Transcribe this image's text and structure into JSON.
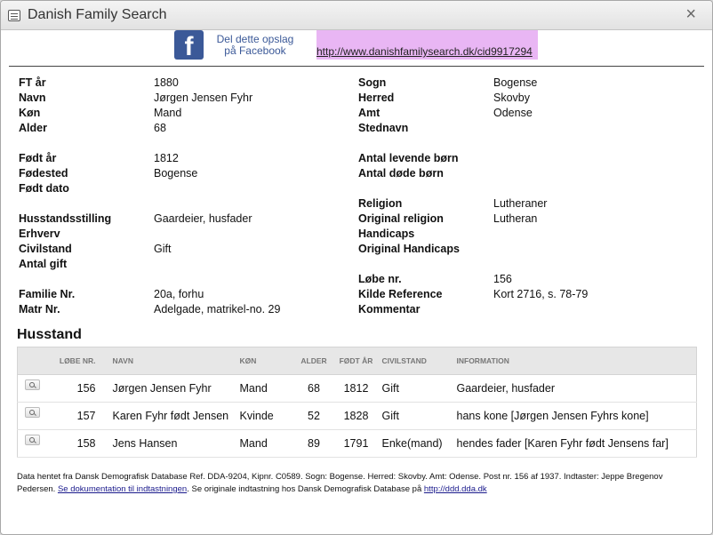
{
  "window": {
    "title": "Danish Family Search",
    "close": "×"
  },
  "share": {
    "facebook_text_line1": "Del dette opslag",
    "facebook_text_line2": "på Facebook",
    "permalink": "http://www.danishfamilysearch.dk/cid9917294",
    "facebook_logo": "f"
  },
  "fields_left": [
    {
      "label": "FT år",
      "value": "1880"
    },
    {
      "label": "Navn",
      "value": "Jørgen Jensen Fyhr"
    },
    {
      "label": "Køn",
      "value": "Mand"
    },
    {
      "label": "Alder",
      "value": "68"
    },
    {
      "label": "Født år",
      "value": "1812"
    },
    {
      "label": "Fødested",
      "value": "Bogense"
    },
    {
      "label": "Født dato",
      "value": ""
    },
    {
      "label": "Husstandsstilling",
      "value": "Gaardeier, husfader"
    },
    {
      "label": "Erhverv",
      "value": ""
    },
    {
      "label": "Civilstand",
      "value": "Gift"
    },
    {
      "label": "Antal gift",
      "value": ""
    },
    {
      "label": "Familie Nr.",
      "value": "20a, forhu"
    },
    {
      "label": "Matr Nr.",
      "value": "Adelgade, matrikel-no. 29"
    }
  ],
  "fields_right": [
    {
      "label": "Sogn",
      "value": "Bogense"
    },
    {
      "label": "Herred",
      "value": "Skovby"
    },
    {
      "label": "Amt",
      "value": "Odense"
    },
    {
      "label": "Stednavn",
      "value": ""
    },
    {
      "label": "Antal levende børn",
      "value": ""
    },
    {
      "label": "Antal døde børn",
      "value": ""
    },
    {
      "label": "Religion",
      "value": "Lutheraner"
    },
    {
      "label": "Original religion",
      "value": "Lutheran"
    },
    {
      "label": "Handicaps",
      "value": ""
    },
    {
      "label": "Original Handicaps",
      "value": ""
    },
    {
      "label": "Løbe nr.",
      "value": "156"
    },
    {
      "label": "Kilde Reference",
      "value": "Kort 2716, s. 78-79"
    },
    {
      "label": "Kommentar",
      "value": ""
    }
  ],
  "household": {
    "title": "Husstand",
    "columns": [
      "LØBE NR.",
      "NAVN",
      "KØN",
      "ALDER",
      "FØDT ÅR",
      "CIVILSTAND",
      "INFORMATION"
    ],
    "rows": [
      {
        "lobe": "156",
        "navn": "Jørgen Jensen Fyhr",
        "kon": "Mand",
        "alder": "68",
        "fodt": "1812",
        "civil": "Gift",
        "info": "Gaardeier, husfader"
      },
      {
        "lobe": "157",
        "navn": "Karen Fyhr født Jensen",
        "kon": "Kvinde",
        "alder": "52",
        "fodt": "1828",
        "civil": "Gift",
        "info": "hans kone [Jørgen Jensen Fyhrs kone]"
      },
      {
        "lobe": "158",
        "navn": "Jens Hansen",
        "kon": "Mand",
        "alder": "89",
        "fodt": "1791",
        "civil": "Enke(mand)",
        "info": "hendes fader [Karen Fyhr født Jensens far]"
      }
    ]
  },
  "footer": {
    "text1": "Data hentet fra Dansk Demografisk Database Ref. DDA-9204, Kipnr. C0589. Sogn: Bogense. Herred: Skovby. Amt: Odense. Post nr. 156 af 1937. Indtaster: Jeppe Bregenov Pedersen. ",
    "link1": "Se dokumentation til indtastningen",
    "text2": ". Se originale indtastning hos Dansk Demografisk Database på ",
    "link2": "http://ddd.dda.dk"
  }
}
